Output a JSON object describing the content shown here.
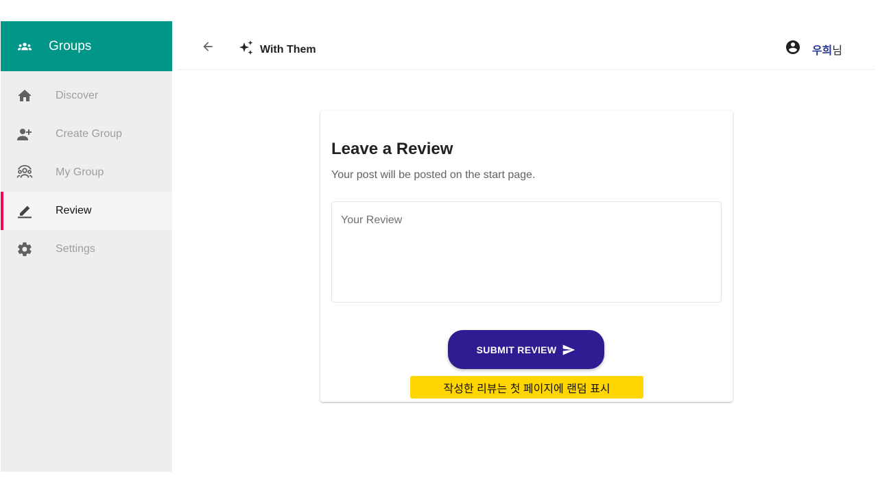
{
  "sidebar": {
    "header_title": "Groups",
    "header_icon": "groups-icon",
    "items": [
      {
        "label": "Discover",
        "icon": "home-icon"
      },
      {
        "label": "Create Group",
        "icon": "person-add-icon"
      },
      {
        "label": "My Group",
        "icon": "group-icon"
      },
      {
        "label": "Review",
        "icon": "rate-review-icon",
        "active": true
      },
      {
        "label": "Settings",
        "icon": "settings-icon"
      }
    ],
    "accent_color": "#f50057",
    "header_color": "#009688"
  },
  "appbar": {
    "back_icon": "arrow-back-icon",
    "brand_icon": "sparkle-icon",
    "brand_name": "With Them",
    "user_icon": "account-circle-icon",
    "user_name": "우희",
    "user_suffix": "님"
  },
  "review_card": {
    "title": "Leave a Review",
    "subtitle": "Your post will be posted on the start page.",
    "review_placeholder": "Your Review",
    "review_value": "",
    "submit_label": "SUBMIT REVIEW",
    "submit_icon": "send-icon",
    "button_color": "#311b92",
    "note": "작성한 리뷰는 첫 페이지에 랜덤 표시",
    "note_color": "#ffd600"
  }
}
